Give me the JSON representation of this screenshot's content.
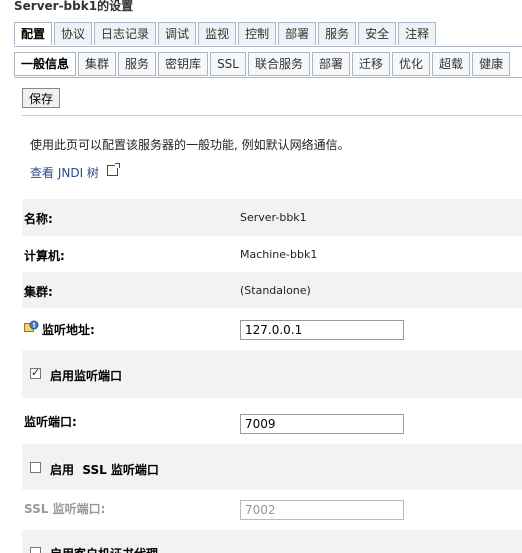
{
  "page": {
    "title": "Server-bbk1的设置"
  },
  "tabs_primary": [
    "配置",
    "协议",
    "日志记录",
    "调试",
    "监视",
    "控制",
    "部署",
    "服务",
    "安全",
    "注释"
  ],
  "tabs_secondary": [
    "一般信息",
    "集群",
    "服务",
    "密钥库",
    "SSL",
    "联合服务",
    "部署",
    "迁移",
    "优化",
    "超载",
    "健康"
  ],
  "toolbar": {
    "save_label": "保存"
  },
  "intro": {
    "description": "使用此页可以配置该服务器的一般功能, 例如默认网络通信。",
    "jndi_link": "查看 JNDI 树"
  },
  "fields": {
    "name": {
      "label": "名称:",
      "value": "Server-bbk1"
    },
    "machine": {
      "label": "计算机:",
      "value": "Machine-bbk1"
    },
    "cluster": {
      "label": "集群:",
      "value": "(Standalone)"
    },
    "listen_address": {
      "label": "监听地址:",
      "value": "127.0.0.1"
    },
    "listen_port_enabled": {
      "label": "启用监听端口",
      "checked": true
    },
    "listen_port": {
      "label": "监听端口:",
      "value": "7009"
    },
    "ssl_enabled": {
      "label": "启用  SSL 监听端口",
      "checked": false
    },
    "ssl_port": {
      "label": "SSL 监听端口:",
      "value": "7002"
    },
    "client_cert_proxy": {
      "label": "启用客户机证书代理",
      "checked": false
    }
  },
  "colors": {
    "tab_border": "#a9b7c6",
    "link": "#2b4c8c",
    "row_shade": "#f2f2f2"
  }
}
